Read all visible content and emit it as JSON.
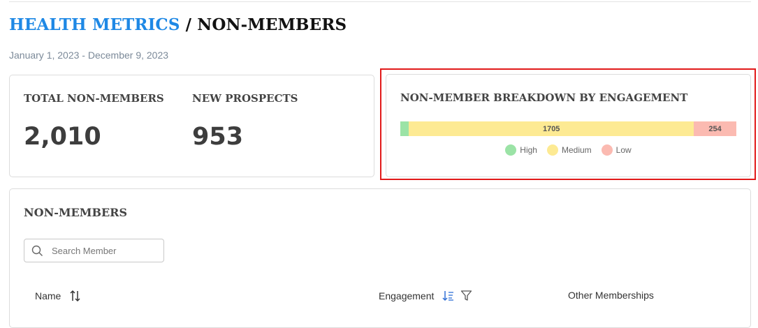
{
  "header": {
    "breadcrumb_link": "HEALTH METRICS",
    "separator": " / ",
    "current": "NON-MEMBERS",
    "date_range": "January 1, 2023 - December 9, 2023"
  },
  "stats": [
    {
      "label": "TOTAL NON-MEMBERS",
      "value": "2,010"
    },
    {
      "label": "NEW PROSPECTS",
      "value": "953"
    }
  ],
  "breakdown": {
    "title": "NON-MEMBER BREAKDOWN BY ENGAGEMENT",
    "segments": [
      {
        "name": "High",
        "value": 51,
        "label": "",
        "color": "#9be3a6"
      },
      {
        "name": "Medium",
        "value": 1705,
        "label": "1705",
        "color": "#fdea93"
      },
      {
        "name": "Low",
        "value": 254,
        "label": "254",
        "color": "#fbbab1"
      }
    ],
    "legend": [
      "High",
      "Medium",
      "Low"
    ]
  },
  "table": {
    "title": "NON-MEMBERS",
    "search_placeholder": "Search Member",
    "columns": [
      "Name",
      "Engagement",
      "Other Memberships"
    ]
  },
  "icons": {
    "search": "search-icon",
    "sort": "sort-icon",
    "sort_desc": "sort-descending-icon",
    "filter": "filter-icon"
  },
  "colors": {
    "accent": "#1e88e5",
    "highlight": "#e11a1a"
  }
}
